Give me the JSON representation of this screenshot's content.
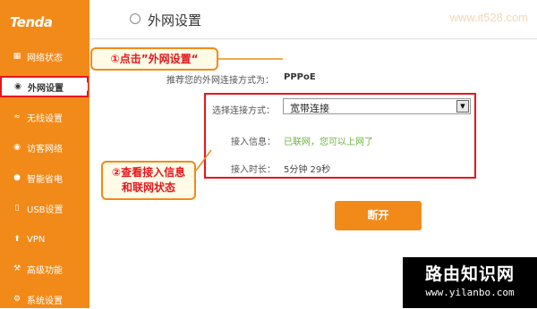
{
  "brand": {
    "logo_text": "Tenda",
    "accent": "#f28a1a",
    "highlight": "#e8151d"
  },
  "sidebar": {
    "items": [
      {
        "label": "网络状态",
        "icon": "network-icon"
      },
      {
        "label": "外网设置",
        "icon": "globe-icon",
        "active": true
      },
      {
        "label": "无线设置",
        "icon": "wifi-icon"
      },
      {
        "label": "访客网络",
        "icon": "guest-icon"
      },
      {
        "label": "智能省电",
        "icon": "power-icon"
      },
      {
        "label": "USB设置",
        "icon": "usb-icon"
      },
      {
        "label": "VPN",
        "icon": "vpn-icon"
      },
      {
        "label": "高级功能",
        "icon": "wrench-icon"
      },
      {
        "label": "系统设置",
        "icon": "settings-icon"
      }
    ]
  },
  "header": {
    "title": "外网设置",
    "watermark": "www.it528.com"
  },
  "main": {
    "recommend_label": "推荐您的外网连接方式为：",
    "recommend_value": "PPPoE",
    "connection_label": "选择连接方式：",
    "connection_value": "宽带连接",
    "access_info_label": "接入信息：",
    "access_info_value": "已联网，您可以上网了",
    "duration_label": "接入时长：",
    "duration_value": "5分钟 29秒",
    "disconnect_label": "断开"
  },
  "callouts": {
    "step1": "①点击”外网设置“",
    "step2_line1": "②查看接入信息",
    "step2_line2": "和联网状态"
  },
  "watermark": {
    "title": "路由知识网",
    "url": "www.yilanbo.com"
  }
}
